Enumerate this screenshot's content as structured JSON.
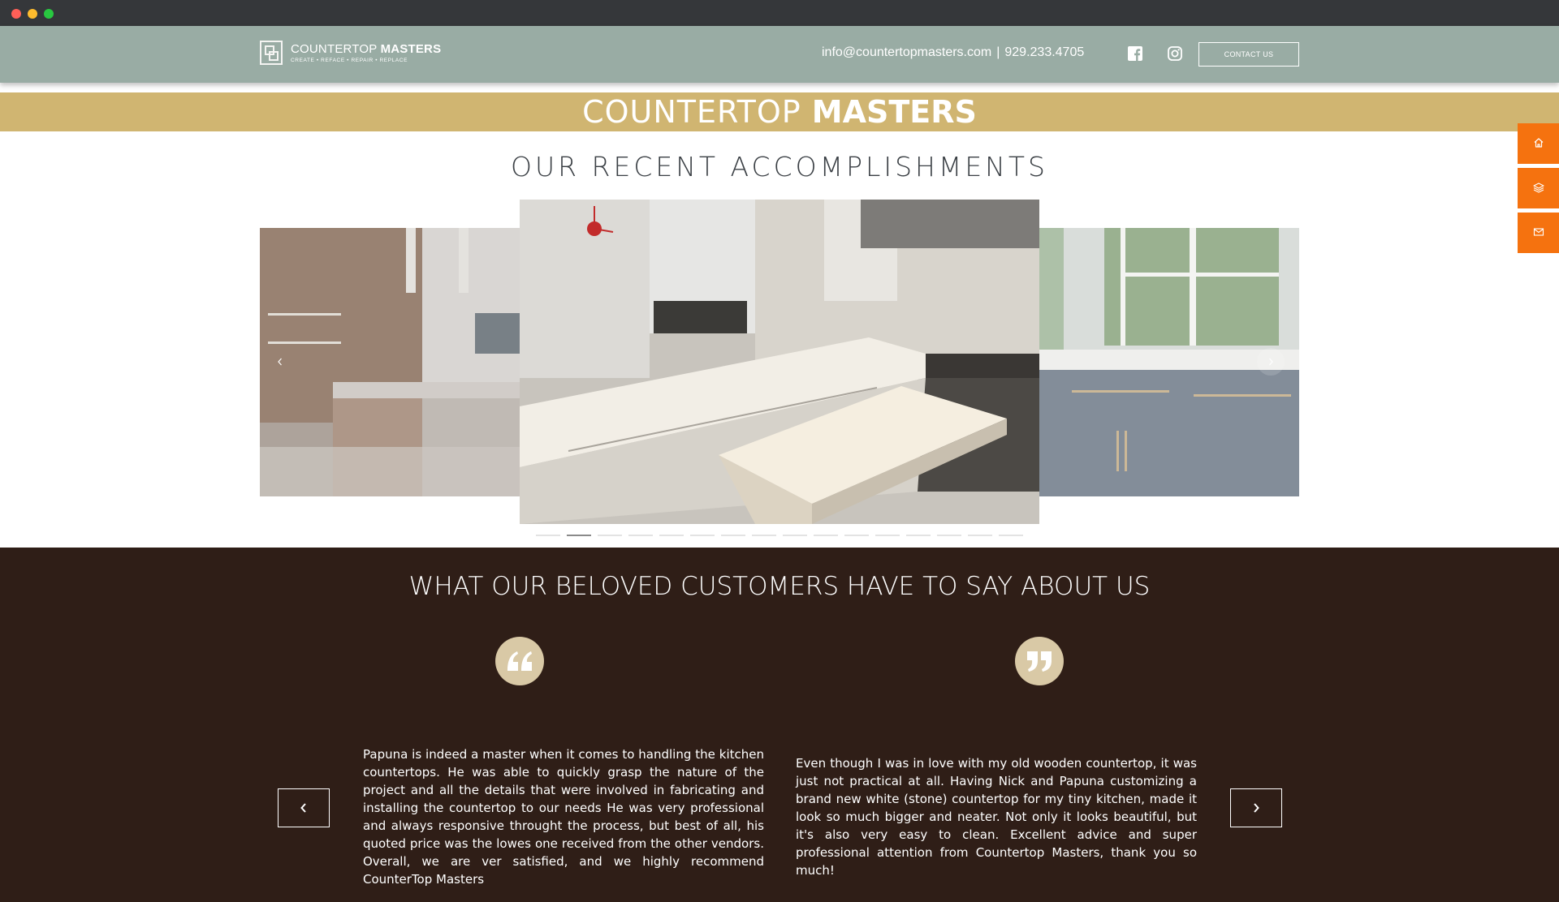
{
  "header": {
    "logo": {
      "title_light": "COUNTERTOP ",
      "title_bold": "MASTERS",
      "tagline": "CREATE • REFACE • REPAIR • REPLACE"
    },
    "email": "info@countertopmasters.com",
    "separator": "|",
    "phone": "929.233.4705",
    "social": [
      "facebook-icon",
      "instagram-icon"
    ],
    "contact_button": "CONTACT US"
  },
  "banner": {
    "title_light": "COUNTERTOP ",
    "title_bold": "MASTERS"
  },
  "side_nav": [
    "home-icon",
    "layers-icon",
    "mail-icon"
  ],
  "gallery": {
    "title": "OUR RECENT ACCOMPLISHMENTS",
    "slide_count": 16,
    "active_slide": 2
  },
  "testimonials": {
    "title": "WHAT OUR BELOVED CUSTOMERS HAVE TO SAY ABOUT US",
    "items": [
      {
        "text": "Papuna is indeed a master when it comes to handling the kitchen countertops. He was able to quickly grasp the nature of the project and all the details that were involved in fabricating and installing the countertop to our needs He was very professional and always responsive throught the process, but best of all, his quoted price was the lowes one received from the other vendors. Overall, we are ver satisfied, and we highly recommend CounterTop Masters"
      },
      {
        "text": "Even though I was in love with my old wooden countertop, it was just not practical at all. Having Nick and Papuna customizing a brand new white (stone) countertop for my tiny kitchen, made it look so much bigger and neater. Not only it looks beautiful, but it's also very easy to clean. Excellent advice and super professional attention from Countertop Masters, thank you so much!"
      }
    ]
  },
  "colors": {
    "header_bg": "#99aca4",
    "banner_bg": "#d0b571",
    "accent": "#f5720f",
    "testimonials_bg": "#2f1e17",
    "quote_circle": "#d9c9a6"
  }
}
